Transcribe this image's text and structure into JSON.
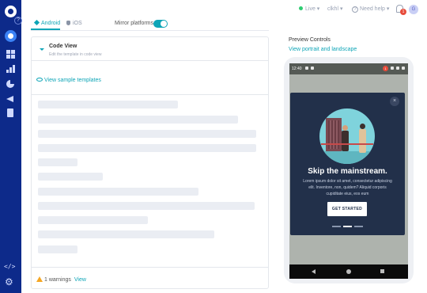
{
  "topbar": {
    "live_label": "Live",
    "account_label": "clkhl",
    "help_label": "Need help",
    "notification_count": "1",
    "avatar_initial": "G"
  },
  "sidebar": {
    "help_glyph": "?",
    "items": [
      {
        "name": "dashboard",
        "icon": "dashboard-icon",
        "active": true
      },
      {
        "name": "templates",
        "icon": "grid-icon"
      },
      {
        "name": "analytics",
        "icon": "bar-chart-icon"
      },
      {
        "name": "reports",
        "icon": "pie-chart-icon"
      },
      {
        "name": "campaigns",
        "icon": "megaphone-icon"
      },
      {
        "name": "documents",
        "icon": "document-icon"
      }
    ],
    "bottom": [
      {
        "name": "developer",
        "icon": "code-icon",
        "glyph": "</>"
      },
      {
        "name": "settings",
        "icon": "gear-icon",
        "glyph": "⚙"
      }
    ]
  },
  "tabs": {
    "android": "Android",
    "ios": "iOS",
    "mirror_label": "Mirror platforms",
    "mirror_on": true
  },
  "editor": {
    "title": "Code View",
    "subtitle": "Edit the template in code view",
    "sample_link": "View sample templates",
    "warnings": "1 warnings",
    "view_link": "View"
  },
  "preview": {
    "title": "Preview Controls",
    "link": "View portrait and landscape",
    "status_time": "12:40",
    "status_badge": "1",
    "modal": {
      "close_glyph": "×",
      "title": "Skip the mainstream.",
      "body": "Lorem ipsum dolor sit amet, consectetur adipiscing elit. Inventore, non, quidem? Aliquid corporis cupiditate eius, eos eum",
      "button": "GET STARTED",
      "pages": 3,
      "active_page": 2
    }
  },
  "colors": {
    "sidebar": "#0d2a8a",
    "accent": "#0ea5b7",
    "modal_bg": "#22304a"
  }
}
